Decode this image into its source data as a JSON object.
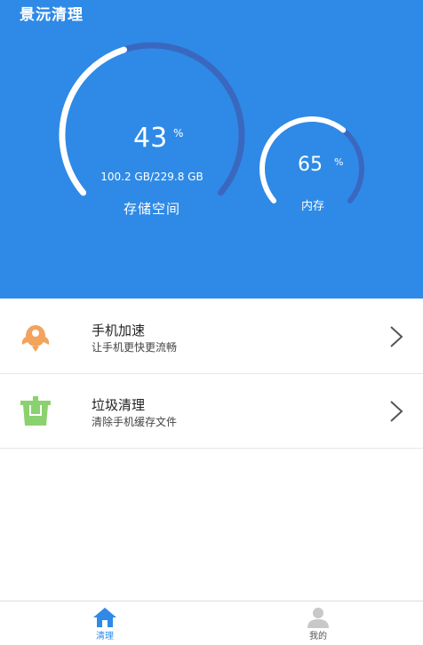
{
  "app": {
    "title": "景沅清理"
  },
  "storage": {
    "percent": "43",
    "percent_sign": "%",
    "used_total": "100.2 GB/229.8 GB",
    "label": "存储空间",
    "fraction": 0.43
  },
  "memory": {
    "percent": "65",
    "percent_sign": "%",
    "label": "内存",
    "fraction": 0.65
  },
  "menu": [
    {
      "title": "手机加速",
      "desc": "让手机更快更流畅",
      "icon": "rocket-icon"
    },
    {
      "title": "垃圾清理",
      "desc": "清除手机缓存文件",
      "icon": "trash-icon"
    }
  ],
  "nav": [
    {
      "label": "清理",
      "icon": "home-icon",
      "active": true
    },
    {
      "label": "我的",
      "icon": "user-icon",
      "active": false
    }
  ],
  "colors": {
    "header_bg": "#2e8ae6",
    "gauge_track": "#3a68c0",
    "gauge_fill": "#ffffff",
    "rocket": "#f2a35c",
    "trash": "#8bd16f",
    "nav_active": "#2e8ae6"
  }
}
